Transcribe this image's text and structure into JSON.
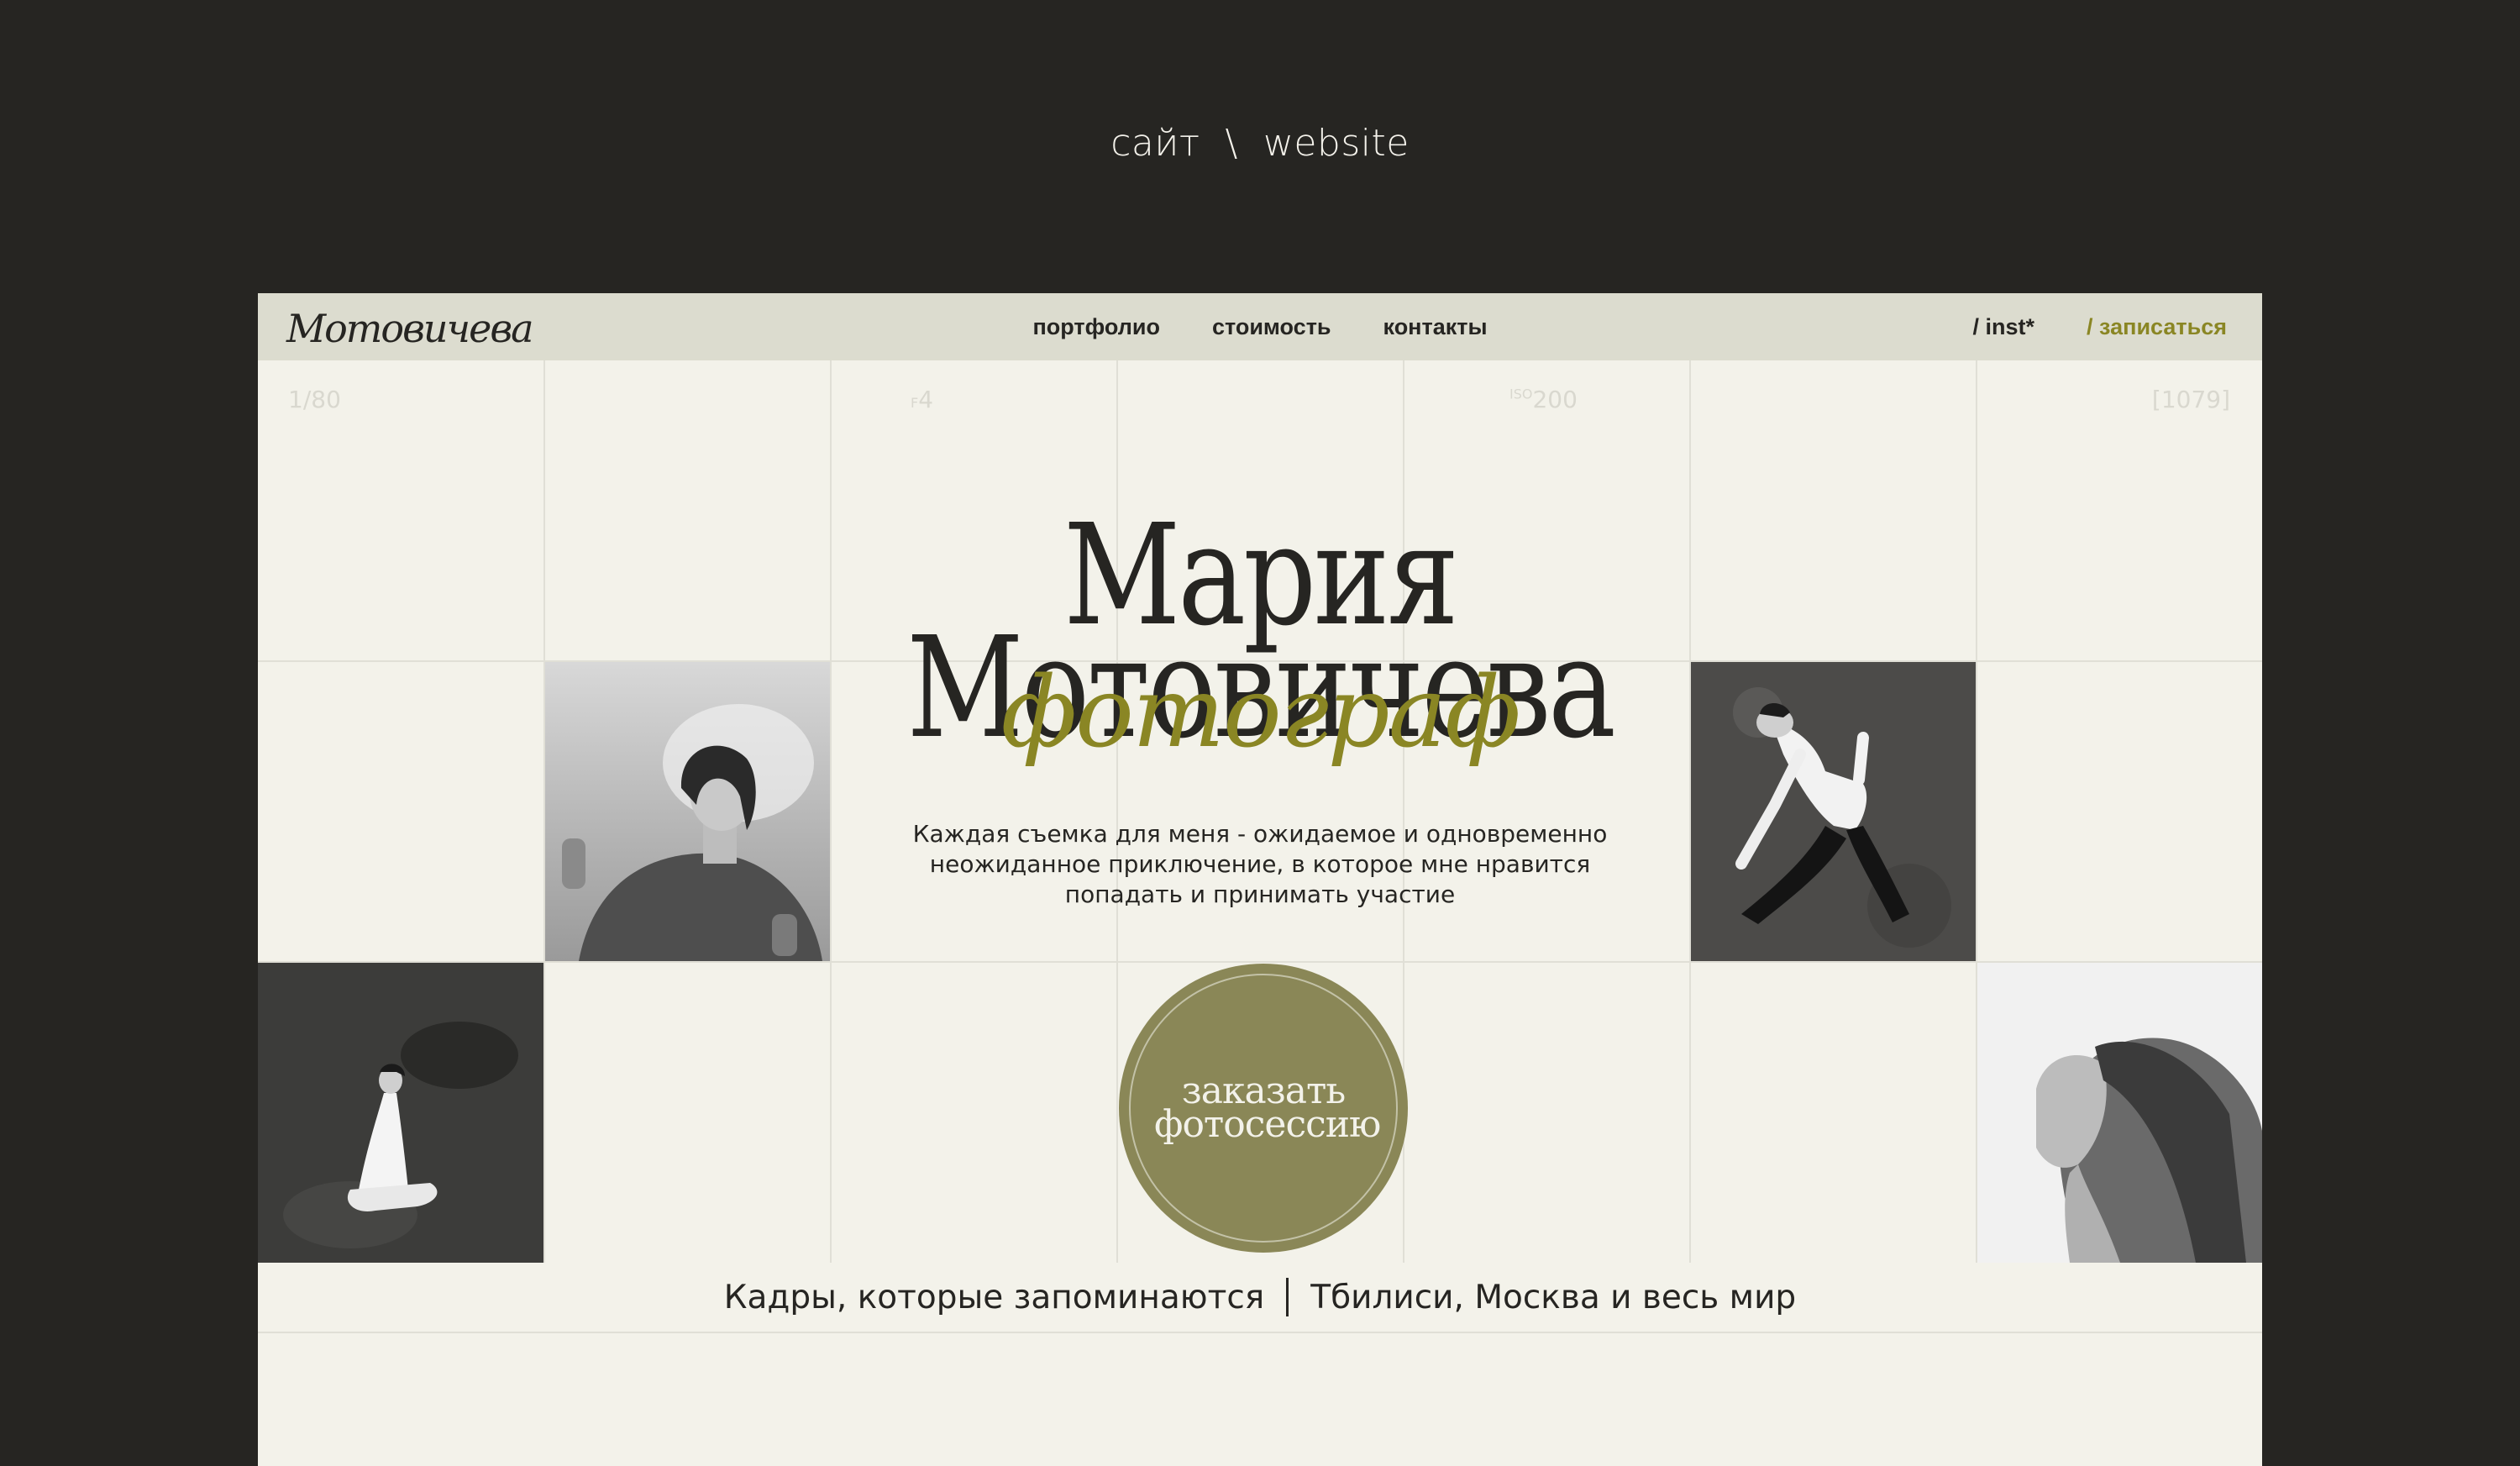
{
  "caption": {
    "left": "сайт",
    "separator": "\\",
    "right": "website"
  },
  "header": {
    "logo_text": "Мотовичева",
    "nav": [
      "портфолио",
      "стоимость",
      "контакты"
    ],
    "inst": "/ inst*",
    "signup": "/ записаться"
  },
  "camera_meta": {
    "shutter": "1/80",
    "aperture_prefix": "F",
    "aperture_value": "4",
    "iso_prefix": "ISO",
    "iso_value": "200",
    "frame": "[1079]"
  },
  "hero": {
    "title_line1": "Мария",
    "title_line2": "Мотовичева",
    "subtitle": "фотограф",
    "description_lines": [
      "Каждая съемка для меня - ожидаемое и одновременно",
      "неожиданное приключение, в которое мне нравится",
      "попадать и принимать участие"
    ],
    "order_button": "заказать фотосессию"
  },
  "tagline": {
    "left": "Кадры, которые запоминаются",
    "right": "Тбилиси, Москва и весь мир"
  },
  "colors": {
    "background": "#262522",
    "page": "#f3f2ea",
    "header": "#dcdccf",
    "accent": "#8a8624",
    "button": "#8a8757"
  }
}
